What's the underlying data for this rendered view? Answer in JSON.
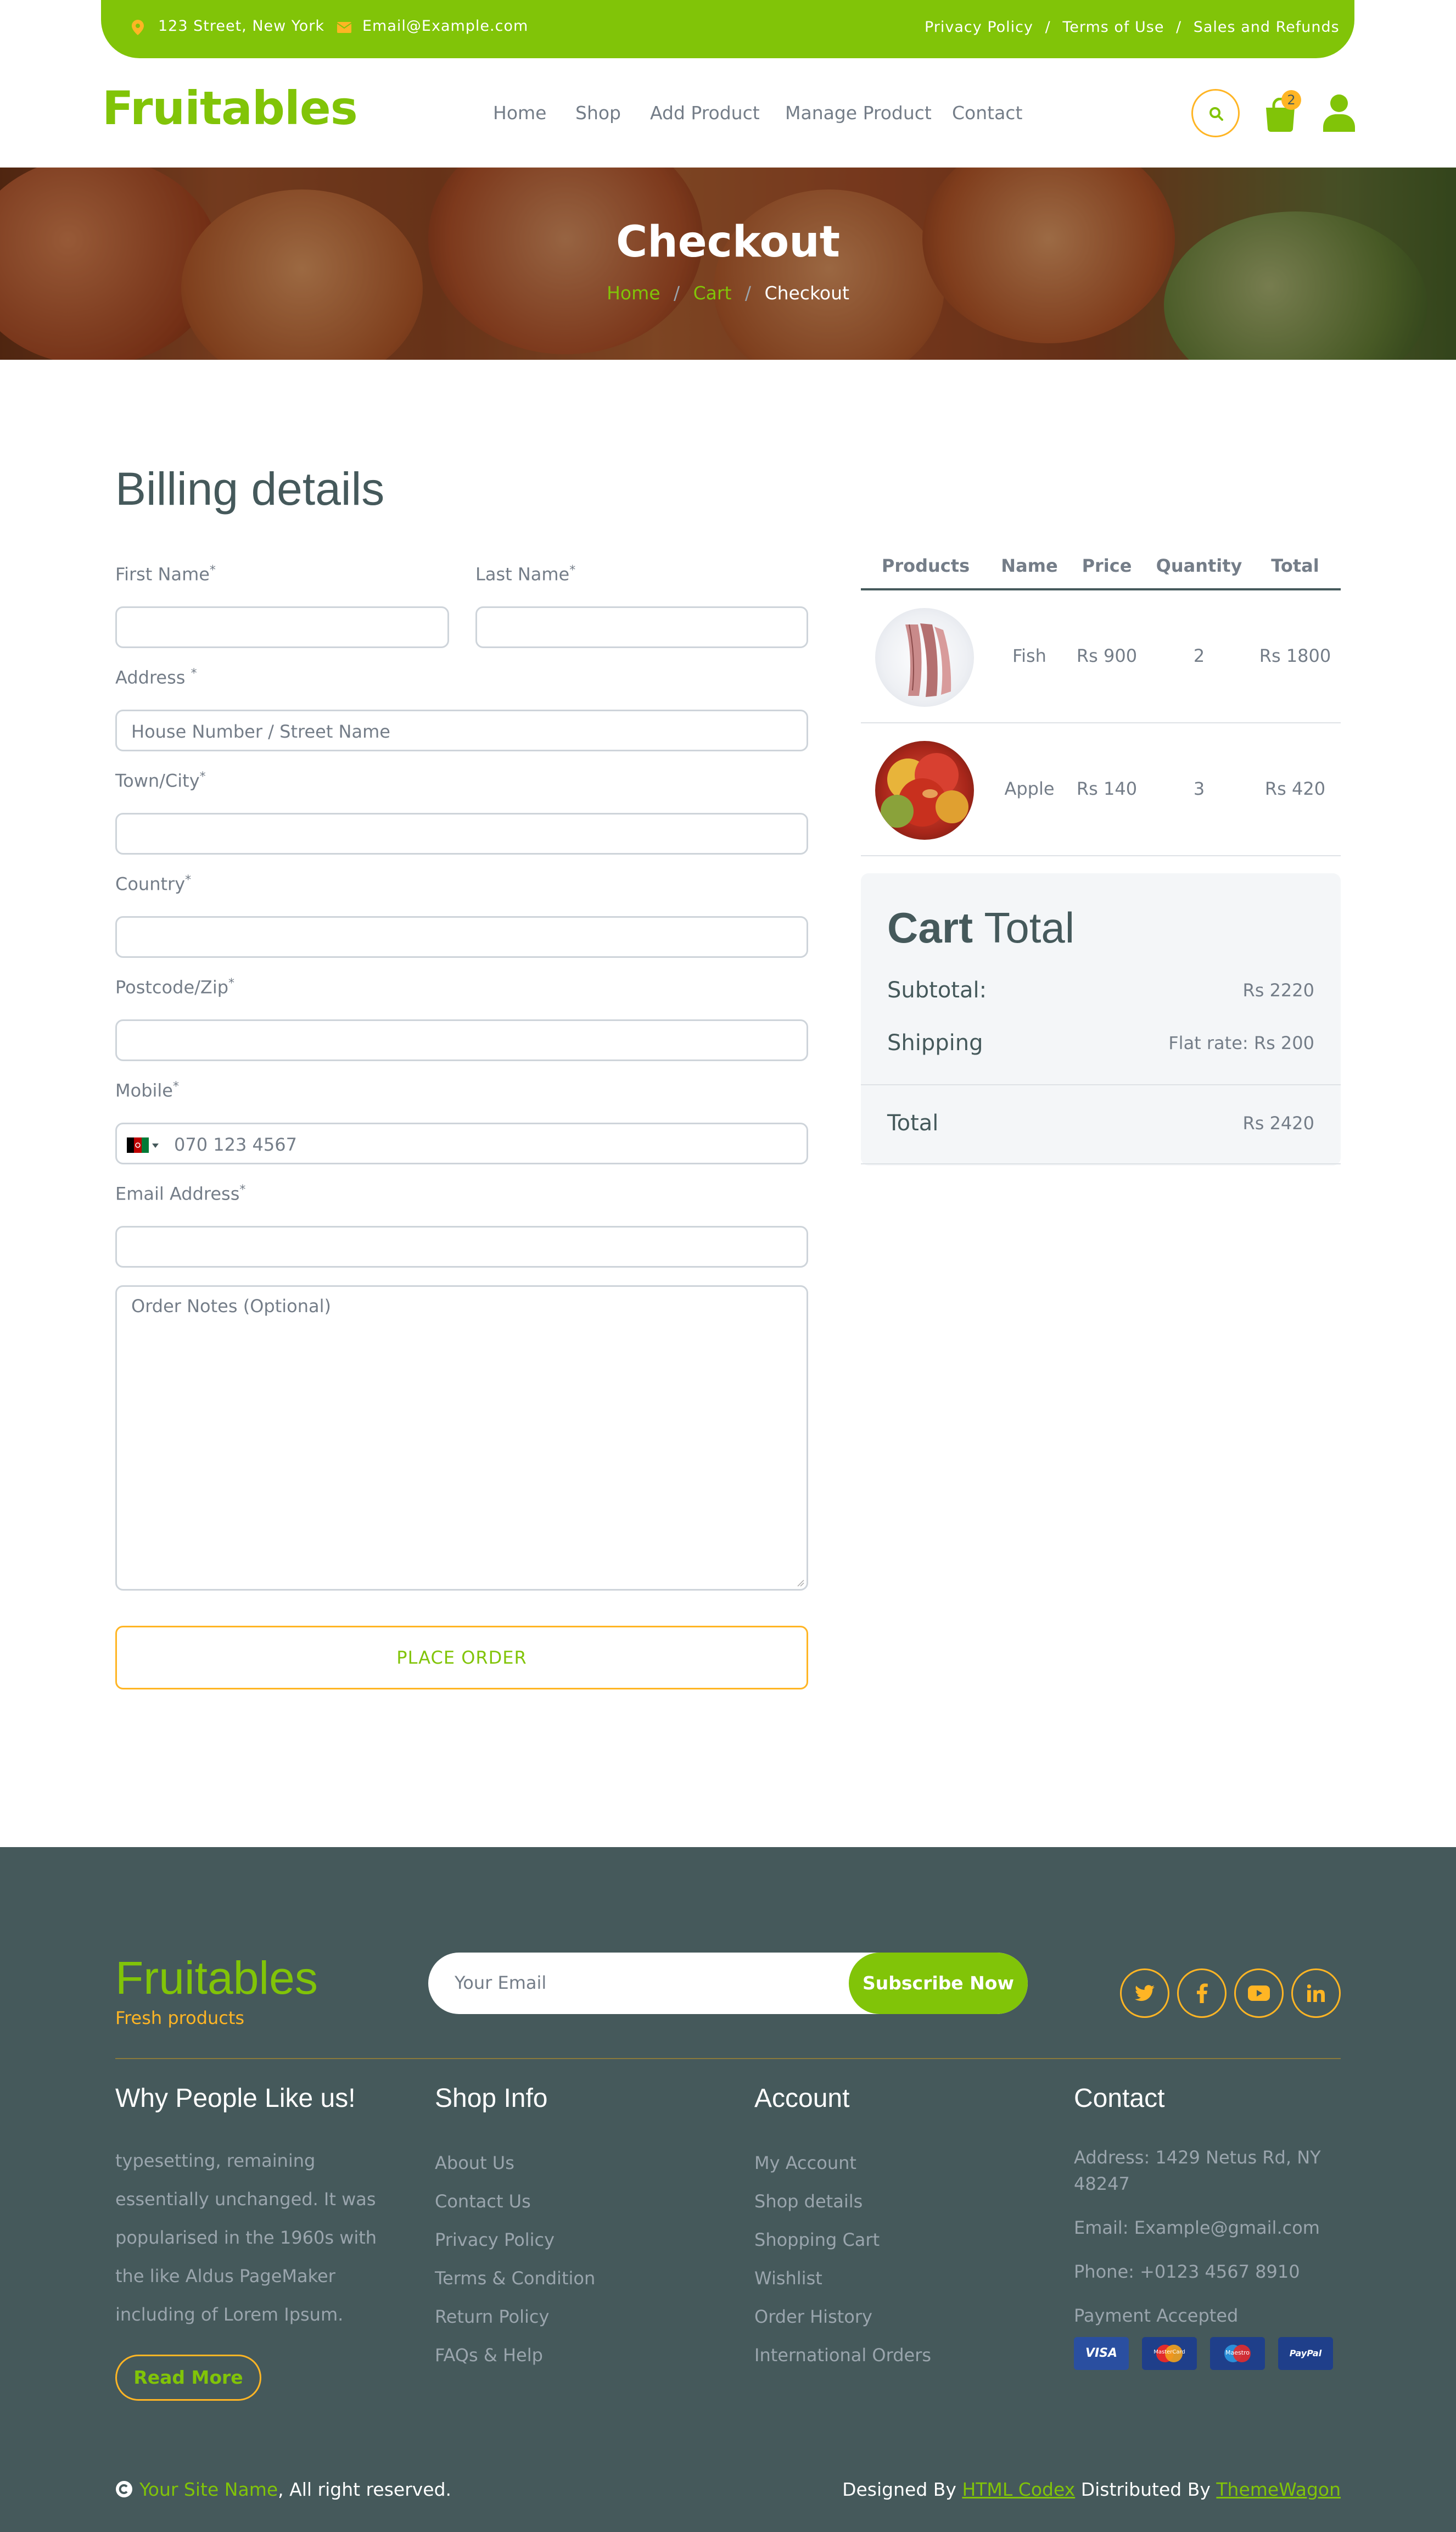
{
  "topbar": {
    "address": "123 Street, New York",
    "email": "Email@Example.com",
    "links": [
      "Privacy Policy",
      "Terms of Use",
      "Sales and Refunds"
    ],
    "separator": "/",
    "address_icon": "map-marker-icon",
    "email_icon": "envelope-icon"
  },
  "nav": {
    "logo": "Fruitables",
    "items": [
      "Home",
      "Shop",
      "Add Product",
      "Manage Product",
      "Contact"
    ],
    "cart_count": "2",
    "search_icon": "search-icon",
    "cart_icon": "shopping-bag-icon",
    "user_icon": "user-icon"
  },
  "hero": {
    "title": "Checkout",
    "breadcrumb": [
      "Home",
      "Cart",
      "Checkout"
    ],
    "separator": "/"
  },
  "billing": {
    "title": "Billing details",
    "first_name_label": "First Name",
    "last_name_label": "Last Name",
    "address_label": "Address",
    "address_placeholder": "House Number / Street Name",
    "town_label": "Town/City",
    "country_label": "Country",
    "postcode_label": "Postcode/Zip",
    "mobile_label": "Mobile",
    "mobile_placeholder": "070 123 4567",
    "email_label": "Email Address",
    "notes_placeholder": "Order Notes (Optional)",
    "required_mark": "*",
    "place_order": "PLACE ORDER"
  },
  "order_table": {
    "headers": [
      "Products",
      "Name",
      "Price",
      "Quantity",
      "Total"
    ],
    "rows": [
      {
        "name": "Fish",
        "price": "Rs 900",
        "quantity": "2",
        "total": "Rs 1800"
      },
      {
        "name": "Apple",
        "price": "Rs 140",
        "quantity": "3",
        "total": "Rs 420"
      }
    ]
  },
  "cart_total": {
    "title_bold": "Cart",
    "title_light": "Total",
    "subtotal_label": "Subtotal:",
    "subtotal_value": "Rs 2220",
    "shipping_label": "Shipping",
    "shipping_value": "Flat rate: Rs 200",
    "total_label": "Total",
    "total_value": "Rs 2420"
  },
  "footer": {
    "logo": "Fruitables",
    "tagline": "Fresh products",
    "email_placeholder": "Your Email",
    "subscribe": "Subscribe Now",
    "social_icons": [
      "twitter-icon",
      "facebook-icon",
      "youtube-icon",
      "linkedin-icon"
    ],
    "col1_title": "Why People Like us!",
    "col1_text": [
      "typesetting, remaining",
      "essentially unchanged. It was",
      "popularised in the 1960s with",
      "the like Aldus PageMaker",
      "including of Lorem Ipsum."
    ],
    "read_more": "Read More",
    "col2_title": "Shop Info",
    "col2_links": [
      "About Us",
      "Contact Us",
      "Privacy Policy",
      "Terms & Condition",
      "Return Policy",
      "FAQs & Help"
    ],
    "col3_title": "Account",
    "col3_links": [
      "My Account",
      "Shop details",
      "Shopping Cart",
      "Wishlist",
      "Order History",
      "International Orders"
    ],
    "col4_title": "Contact",
    "address_line1": "Address: 1429 Netus Rd, NY",
    "address_line2": "48247",
    "email": "Email: Example@gmail.com",
    "phone": "Phone: +0123 4567 8910",
    "payment": "Payment Accepted",
    "cards": [
      "VISA",
      "MasterCard",
      "Maestro",
      "PayPal"
    ],
    "copyright_icon": "copyright-icon",
    "site_name": "Your Site Name",
    "rights": ", All right reserved.",
    "designed_by": "Designed By",
    "html_codex": "HTML Codex",
    "distributed_by": "Distributed By",
    "themewagon": "ThemeWagon"
  },
  "colors": {
    "primary": "#81c408",
    "secondary": "#ffb524",
    "dark": "#45595b",
    "muted": "#747d88",
    "light": "#f4f6f8"
  }
}
